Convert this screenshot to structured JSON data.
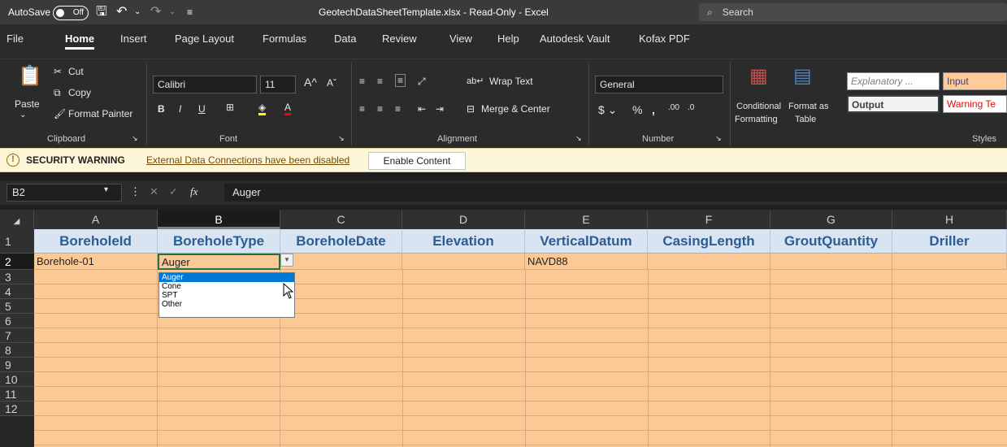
{
  "titlebar": {
    "autosave_label": "AutoSave",
    "autosave_state": "Off",
    "doc_title": "GeotechDataSheetTemplate.xlsx  -  Read-Only  -  Excel",
    "search_placeholder": "Search"
  },
  "menu": [
    "File",
    "Home",
    "Insert",
    "Page Layout",
    "Formulas",
    "Data",
    "Review",
    "View",
    "Help",
    "Autodesk Vault",
    "Kofax PDF"
  ],
  "menu_active": "Home",
  "ribbon": {
    "paste": "Paste",
    "cut": "Cut",
    "copy": "Copy",
    "format_painter": "Format Painter",
    "clipboard": "Clipboard",
    "font_name": "Calibri",
    "font_size": "11",
    "font_group": "Font",
    "wrap_text": "Wrap Text",
    "merge_center": "Merge & Center",
    "alignment": "Alignment",
    "number_format": "General",
    "number": "Number",
    "conditional_formatting_1": "Conditional",
    "conditional_formatting_2": "Formatting",
    "format_as_table_1": "Format as",
    "format_as_table_2": "Table",
    "style_explanatory": "Explanatory ...",
    "style_input": "Input",
    "style_output": "Output",
    "style_warning": "Warning Te",
    "styles": "Styles"
  },
  "security": {
    "title": "SECURITY WARNING",
    "message": "External Data Connections have been disabled",
    "button": "Enable Content"
  },
  "formula_bar": {
    "name_box": "B2",
    "fx": "fx",
    "value": "Auger"
  },
  "columns": [
    "A",
    "B",
    "C",
    "D",
    "E",
    "F",
    "G",
    "H"
  ],
  "rows": [
    "1",
    "2",
    "3",
    "4",
    "5",
    "6",
    "7",
    "8",
    "9",
    "10",
    "11",
    "12"
  ],
  "headers": [
    "BoreholeId",
    "BoreholeType",
    "BoreholeDate",
    "Elevation",
    "VerticalDatum",
    "CasingLength",
    "GroutQuantity",
    "Driller"
  ],
  "row2": [
    "Borehole-01",
    "Auger",
    "",
    "",
    "NAVD88",
    "",
    "",
    ""
  ],
  "dropdown": {
    "options": [
      "Auger",
      "Cone",
      "SPT",
      "Other"
    ],
    "selected": "Auger"
  },
  "colors": {
    "cell_fill": "#fbc996",
    "header_fill": "#d9e4f2",
    "header_text": "#2a5d96",
    "active_border": "#217346",
    "security_bar": "#fdf6d9"
  }
}
